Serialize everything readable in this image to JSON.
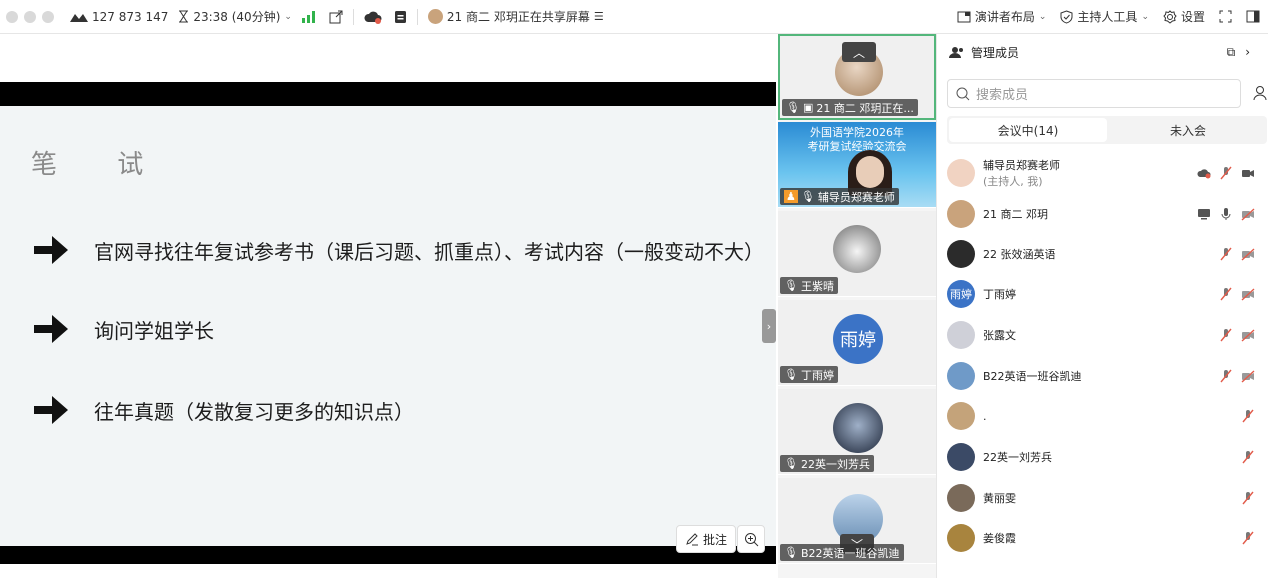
{
  "topbar": {
    "meeting_id": "127 873 147",
    "timer": "23:38 (40分钟)",
    "sharing_text": "21 商二 邓玥正在共享屏幕",
    "layout_label": "演讲者布局",
    "host_tools_label": "主持人工具",
    "settings_label": "设置"
  },
  "slide": {
    "title": "笔 试",
    "bullets": [
      "官网寻找往年复试参考书（课后习题、抓重点）、考试内容（一般变动不大）",
      "询问学姐学长",
      "往年真题（发散复习更多的知识点）"
    ],
    "annotate_label": "批注"
  },
  "videos": {
    "tiles": [
      {
        "name": "21 商二 邓玥正在..."
      },
      {
        "name": "辅导员郑赛老师",
        "banner_line1": "外国语学院2026年",
        "banner_line2": "考研复试经验交流会"
      },
      {
        "name": "王紫晴"
      },
      {
        "name": "丁雨婷",
        "avatar_text": "雨婷"
      },
      {
        "name": "22英一刘芳兵"
      },
      {
        "name": "B22英语一班谷凯迪"
      }
    ]
  },
  "panel": {
    "title": "管理成员",
    "search_placeholder": "搜索成员",
    "tab_in_meeting": "会议中(14)",
    "tab_not_joined": "未入会",
    "members": [
      {
        "name": "辅导员郑赛老师",
        "sub": "(主持人, 我)",
        "color": "#f1d3c2"
      },
      {
        "name": "21 商二 邓玥",
        "sub": "",
        "color": "#c9a37c"
      },
      {
        "name": "22 张效涵英语",
        "sub": "",
        "color": "#2b2b2b"
      },
      {
        "name": "丁雨婷",
        "sub": "",
        "color": "#3b73c6",
        "avatar_text": "雨婷"
      },
      {
        "name": "张露文",
        "sub": "",
        "color": "#cfd0d8"
      },
      {
        "name": "B22英语一班谷凯迪",
        "sub": "",
        "color": "#6f9ac8"
      },
      {
        "name": ".",
        "sub": "",
        "color": "#c4a37a"
      },
      {
        "name": "22英一刘芳兵",
        "sub": "",
        "color": "#3b4a66"
      },
      {
        "name": "黄丽雯",
        "sub": "",
        "color": "#7a6a5a"
      },
      {
        "name": "姜俊霞",
        "sub": "",
        "color": "#a8843e"
      }
    ]
  },
  "colors": {
    "accent_green": "#31b34c",
    "active_tile_border": "#53b67b",
    "blue_avatar": "#3b73c6",
    "muted_red": "#e25b4a"
  }
}
